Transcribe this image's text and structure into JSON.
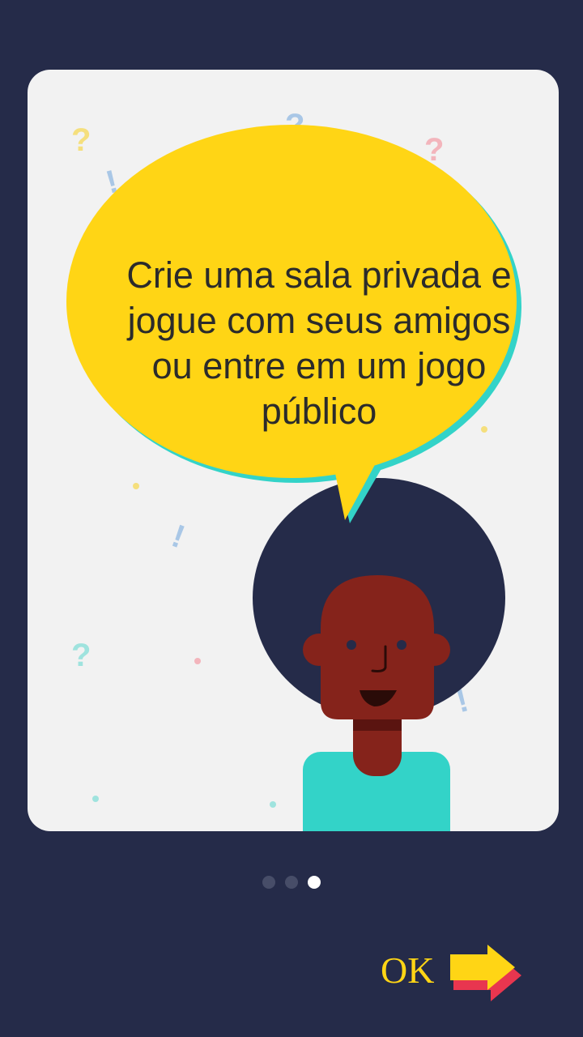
{
  "onboarding": {
    "message_parts": [
      {
        "text": "Crie uma sala privada e ",
        "bold": false
      },
      {
        "text": "jogue com seus amigos",
        "bold": true
      },
      {
        "text": " ou ",
        "bold": false
      },
      {
        "text": "entre em um jogo público",
        "bold": true
      }
    ],
    "page_indicator": {
      "total": 3,
      "current": 3
    },
    "ok_label": "OK"
  },
  "colors": {
    "background": "#252b49",
    "card": "#f2f2f2",
    "bubble": "#ffd515",
    "bubble_shadow": "#33d3c8",
    "hair": "#252b49",
    "skin": "#85231b",
    "shirt": "#33d3c8",
    "arrow": "#ffd515",
    "arrow_shadow": "#e8364f"
  },
  "icons": {
    "ok_arrow": "arrow-right-icon",
    "decorations": [
      "question-mark-icon",
      "exclamation-mark-icon"
    ]
  }
}
